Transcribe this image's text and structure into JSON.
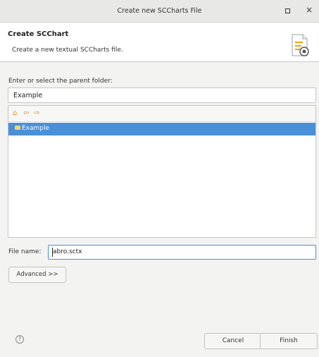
{
  "window": {
    "title": "Create new SCCharts File"
  },
  "header": {
    "title": "Create SCChart",
    "description": "Create a new textual SCCharts file."
  },
  "folder": {
    "label": "Enter or select the parent folder:",
    "value": "Example"
  },
  "tree": {
    "items": [
      {
        "label": "Example",
        "selected": true
      }
    ]
  },
  "file_name": {
    "label": "File name:",
    "value": "abro.sctx"
  },
  "buttons": {
    "advanced": "Advanced >>",
    "cancel": "Cancel",
    "finish": "Finish"
  },
  "colors": {
    "selection": "#4a90d9",
    "folder": "#f4d36b"
  }
}
